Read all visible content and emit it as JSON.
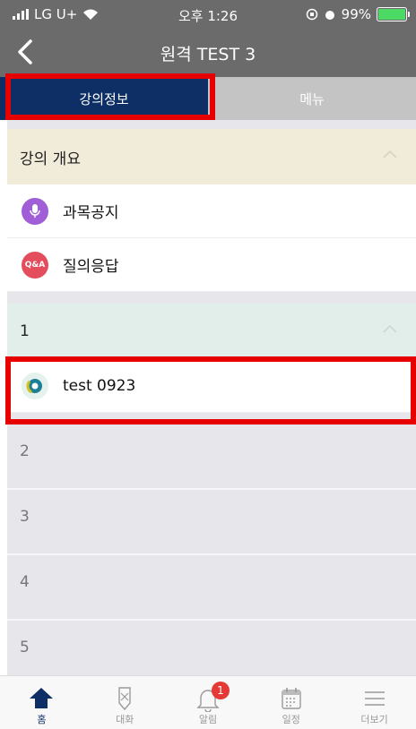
{
  "status_bar": {
    "carrier": "LG U+",
    "time": "오후 1:26",
    "battery": "99%"
  },
  "header": {
    "title": "원격 TEST 3"
  },
  "tabs": [
    {
      "label": "강의정보",
      "active": true
    },
    {
      "label": "메뉴",
      "active": false
    }
  ],
  "overview_section": {
    "title": "강의 개요",
    "items": [
      {
        "label": "과목공지",
        "icon": "microphone-icon",
        "color": "#a05fd6"
      },
      {
        "label": "질의응답",
        "icon": "qa-icon",
        "icon_text": "Q&A",
        "color": "#e34d5c"
      }
    ]
  },
  "week_sections": [
    {
      "title": "1",
      "items": [
        {
          "label": "test 0923",
          "icon": "video-icon"
        }
      ]
    },
    {
      "title": "2"
    },
    {
      "title": "3"
    },
    {
      "title": "4"
    },
    {
      "title": "5"
    }
  ],
  "bottom_nav": [
    {
      "label": "홈",
      "icon": "home-icon",
      "active": true
    },
    {
      "label": "대화",
      "icon": "chat-icon"
    },
    {
      "label": "알림",
      "icon": "bell-icon",
      "badge": "1"
    },
    {
      "label": "일정",
      "icon": "calendar-icon"
    },
    {
      "label": "더보기",
      "icon": "menu-icon"
    }
  ],
  "colors": {
    "nav_bg": "#6b6b6b",
    "tab_active": "#0d2f66",
    "tab_inactive": "#c4c4c4",
    "highlight": "#e60000",
    "overview_header": "#f1ebd9",
    "week1_header": "#e1eeea"
  }
}
